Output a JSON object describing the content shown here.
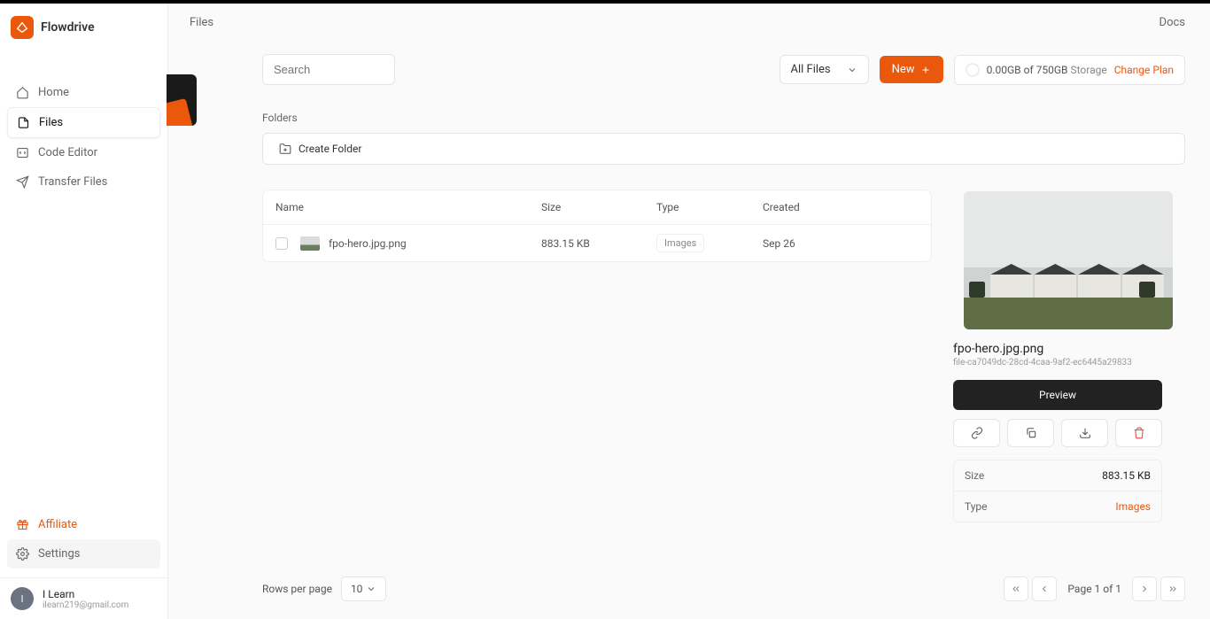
{
  "brand": "Flowdrive",
  "topbar": {
    "breadcrumb": "Files",
    "docs": "Docs"
  },
  "nav": {
    "home": "Home",
    "files": "Files",
    "code_editor": "Code Editor",
    "transfer": "Transfer Files",
    "affiliate": "Affiliate",
    "settings": "Settings"
  },
  "user": {
    "initial": "I",
    "name": "I Learn",
    "email": "ilearn219@gmail.com"
  },
  "toolbar": {
    "search_placeholder": "Search",
    "filter": "All Files",
    "new_label": "New",
    "storage_used": "0.00GB",
    "storage_of": " of ",
    "storage_total": "750GB",
    "storage_label": " Storage",
    "change_plan": "Change Plan"
  },
  "folders": {
    "label": "Folders",
    "create": "Create Folder"
  },
  "table": {
    "headers": {
      "name": "Name",
      "size": "Size",
      "type": "Type",
      "created": "Created"
    },
    "rows": [
      {
        "name": "fpo-hero.jpg.png",
        "size": "883.15 KB",
        "type": "Images",
        "created": "Sep 26"
      }
    ]
  },
  "detail": {
    "filename": "fpo-hero.jpg.png",
    "id": "file-ca7049dc-28cd-4caa-9af2-ec6445a29833",
    "preview_btn": "Preview",
    "meta": {
      "size_k": "Size",
      "size_v": "883.15 KB",
      "type_k": "Type",
      "type_v": "Images"
    }
  },
  "footer": {
    "rows_label": "Rows per page",
    "rows_value": "10",
    "page_info": "Page 1 of 1"
  }
}
